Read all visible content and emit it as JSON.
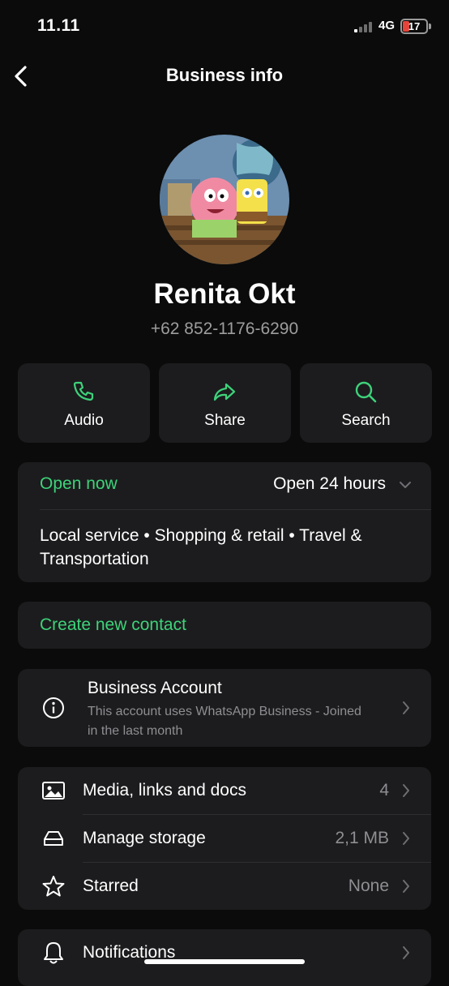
{
  "status": {
    "time": "11.11",
    "network": "4G",
    "battery": "17"
  },
  "header": {
    "title": "Business info"
  },
  "profile": {
    "name": "Renita Okt",
    "phone": "+62 852-1176-6290"
  },
  "actions": [
    {
      "label": "Audio",
      "icon": "phone-icon"
    },
    {
      "label": "Share",
      "icon": "share-icon"
    },
    {
      "label": "Search",
      "icon": "search-icon"
    }
  ],
  "hours": {
    "status": "Open now",
    "value": "Open 24 hours",
    "categories": "Local service • Shopping & retail • Travel & Transportation"
  },
  "create_contact": "Create new contact",
  "business_account": {
    "title": "Business Account",
    "subtitle": "This account uses WhatsApp Business - Joined in the last month"
  },
  "media_section": [
    {
      "label": "Media, links and docs",
      "value": "4",
      "icon": "image-icon"
    },
    {
      "label": "Manage storage",
      "value": "2,1 MB",
      "icon": "storage-icon"
    },
    {
      "label": "Starred",
      "value": "None",
      "icon": "star-icon"
    }
  ],
  "notifications": {
    "label": "Notifications",
    "icon": "bell-icon"
  },
  "colors": {
    "accent": "#3ed27a",
    "background": "#0b0b0b",
    "card": "#1c1c1e",
    "battery_low": "#e5443a"
  }
}
